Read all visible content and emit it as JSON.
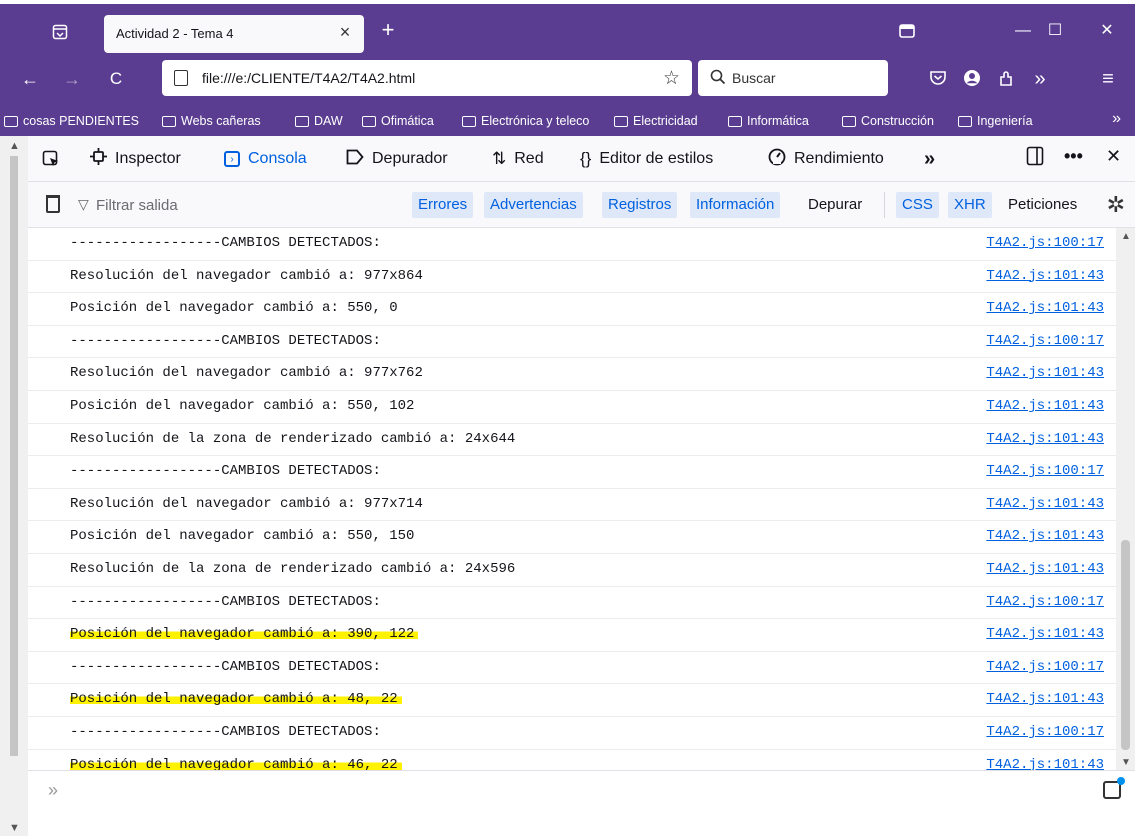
{
  "browser": {
    "tab_title": "Actividad 2 - Tema 4",
    "tab_close": "×",
    "new_tab": "+",
    "url": "file:///e:/CLIENTE/T4A2/T4A2.html",
    "search_placeholder": "Buscar",
    "window_buttons": {
      "minimize": "—",
      "maximize": "☐",
      "close": "✕"
    },
    "nav_glyphs": {
      "back": "←",
      "forward": "→",
      "reload": "C",
      "overflow": "»",
      "menu": "≡"
    }
  },
  "bookmarks": [
    {
      "label": "cosas PENDIENTES"
    },
    {
      "label": "Webs cañeras"
    },
    {
      "label": "DAW"
    },
    {
      "label": "Ofimática"
    },
    {
      "label": "Electrónica y teleco"
    },
    {
      "label": "Electricidad"
    },
    {
      "label": "Informática"
    },
    {
      "label": "Construcción"
    },
    {
      "label": "Ingeniería"
    }
  ],
  "devtools": {
    "tools": [
      {
        "label": "Inspector"
      },
      {
        "label": "Consola"
      },
      {
        "label": "Depurador"
      },
      {
        "label": "Red"
      },
      {
        "label": "Editor de estilos"
      },
      {
        "label": "Rendimiento"
      }
    ],
    "more_tools": "»",
    "filter_placeholder": "Filtrar salida",
    "filters": [
      {
        "label": "Errores",
        "active": true
      },
      {
        "label": "Advertencias",
        "active": true
      },
      {
        "label": "Registros",
        "active": true
      },
      {
        "label": "Información",
        "active": true
      },
      {
        "label": "Depurar",
        "active": false
      },
      {
        "label": "CSS",
        "active": true
      },
      {
        "label": "XHR",
        "active": true
      },
      {
        "label": "Peticiones",
        "active": false
      }
    ],
    "prompt": "»"
  },
  "console": {
    "rows": [
      {
        "msg": "------------------CAMBIOS DETECTADOS:",
        "src": "T4A2.js:100:17",
        "highlight": false
      },
      {
        "msg": "Resolución del navegador cambió a: 977x864",
        "src": "T4A2.js:101:43",
        "highlight": false
      },
      {
        "msg": "Posición del navegador cambió a: 550, 0",
        "src": "T4A2.js:101:43",
        "highlight": false
      },
      {
        "msg": "------------------CAMBIOS DETECTADOS:",
        "src": "T4A2.js:100:17",
        "highlight": false
      },
      {
        "msg": "Resolución del navegador cambió a: 977x762",
        "src": "T4A2.js:101:43",
        "highlight": false
      },
      {
        "msg": "Posición del navegador cambió a: 550, 102",
        "src": "T4A2.js:101:43",
        "highlight": false
      },
      {
        "msg": "Resolución de la zona de renderizado cambió a: 24x644",
        "src": "T4A2.js:101:43",
        "highlight": false
      },
      {
        "msg": "------------------CAMBIOS DETECTADOS:",
        "src": "T4A2.js:100:17",
        "highlight": false
      },
      {
        "msg": "Resolución del navegador cambió a: 977x714",
        "src": "T4A2.js:101:43",
        "highlight": false
      },
      {
        "msg": "Posición del navegador cambió a: 550, 150",
        "src": "T4A2.js:101:43",
        "highlight": false
      },
      {
        "msg": "Resolución de la zona de renderizado cambió a: 24x596",
        "src": "T4A2.js:101:43",
        "highlight": false
      },
      {
        "msg": "------------------CAMBIOS DETECTADOS:",
        "src": "T4A2.js:100:17",
        "highlight": false
      },
      {
        "msg": "Posición del navegador cambió a: 390, 122",
        "src": "T4A2.js:101:43",
        "highlight": true
      },
      {
        "msg": "------------------CAMBIOS DETECTADOS:",
        "src": "T4A2.js:100:17",
        "highlight": false
      },
      {
        "msg": "Posición del navegador cambió a: 48, 22",
        "src": "T4A2.js:101:43",
        "highlight": true
      },
      {
        "msg": "------------------CAMBIOS DETECTADOS:",
        "src": "T4A2.js:100:17",
        "highlight": false
      },
      {
        "msg": "Posición del navegador cambió a: 46, 22",
        "src": "T4A2.js:101:43",
        "highlight": true
      }
    ]
  },
  "colors": {
    "chrome": "#5a3d91",
    "accent": "#0061e0",
    "highlight": "#fff200"
  }
}
